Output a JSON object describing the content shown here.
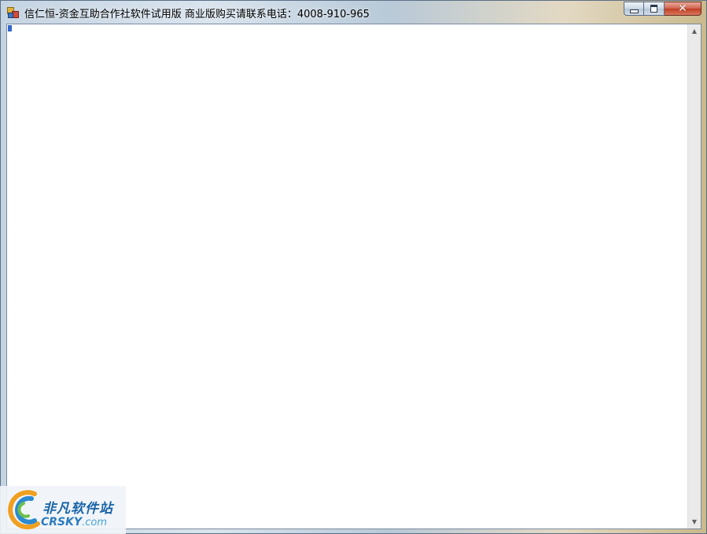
{
  "window": {
    "title": "信仁恒-资金互助合作社软件试用版  商业版购买请联系电话：4008-910-965",
    "app_icon": "app-icon",
    "buttons": {
      "minimize_icon": "minimize-icon",
      "maximize_icon": "maximize-icon",
      "close_glyph": "✕"
    }
  },
  "scrollbar": {
    "up_glyph": "▲",
    "down_glyph": "▼"
  },
  "watermark": {
    "cn_text": "非凡软件站",
    "en_text": "CRSKY",
    "en_domain": ".com"
  },
  "colors": {
    "close_button": "#c03c22",
    "brand_blue": "#1a64a8"
  }
}
